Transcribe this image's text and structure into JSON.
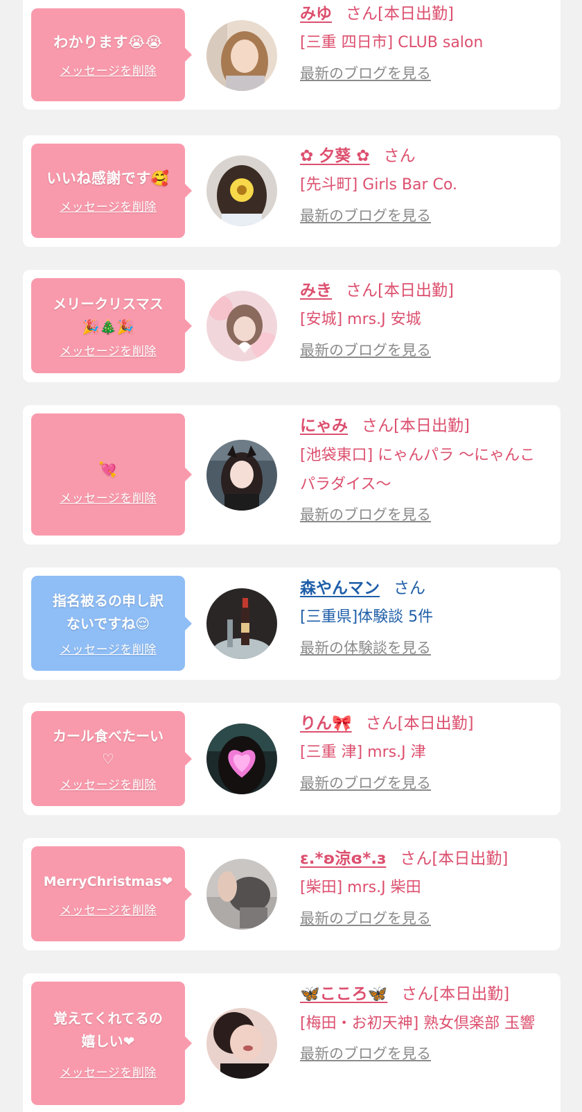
{
  "delete_label": "メッセージを削除",
  "items": [
    {
      "message": "わかります😭😭",
      "name": "みゆ",
      "suffix": "さん[本日出勤]",
      "shop": "[三重 四日市] CLUB salon",
      "link": "最新のブログを見る",
      "bubble_color": "#f99aac"
    },
    {
      "message": "いいね感謝です🥰",
      "name": "✿ 夕葵 ✿",
      "suffix": "さん",
      "shop": "[先斗町] Girls Bar Co.",
      "link": "最新のブログを見る",
      "bubble_color": "#f99aac"
    },
    {
      "message": "メリークリスマス\n🎉🎄🎉",
      "name": "みき",
      "suffix": "さん[本日出勤]",
      "shop": "[安城] mrs.J 安城",
      "link": "最新のブログを見る",
      "bubble_color": "#f99aac"
    },
    {
      "message": "💘",
      "name": "にゃみ",
      "suffix": "さん[本日出勤]",
      "shop": "[池袋東口] にゃんパラ 〜にゃんこパラダイス〜",
      "link": "最新のブログを見る",
      "bubble_color": "#f99aac"
    },
    {
      "message": "指名被るの申し訳\nないですね😌",
      "name": "森やんマン",
      "suffix": "さん",
      "shop": "[三重県]体験談 5件",
      "link": "最新の体験談を見る",
      "bubble_color": "#8fbdf5"
    },
    {
      "message": "カール食べたーい\n♡",
      "name": "りん🎀",
      "suffix": "さん[本日出勤]",
      "shop": "[三重 津] mrs.J 津",
      "link": "最新のブログを見る",
      "bubble_color": "#f99aac"
    },
    {
      "message": "MerryChristmas❤",
      "name": "ε.*ʚ涼ɞ*.з",
      "suffix": "さん[本日出勤]",
      "shop": "[柴田] mrs.J 柴田",
      "link": "最新のブログを見る",
      "bubble_color": "#f99aac"
    },
    {
      "message": "覚えてくれてるの\n嬉しい❤",
      "name": "🦋こころ🦋",
      "suffix": "さん[本日出勤]",
      "shop": "[梅田・お初天神] 熟女倶楽部 玉響",
      "link": "最新のブログを見る",
      "bubble_color": "#f99aac"
    }
  ]
}
